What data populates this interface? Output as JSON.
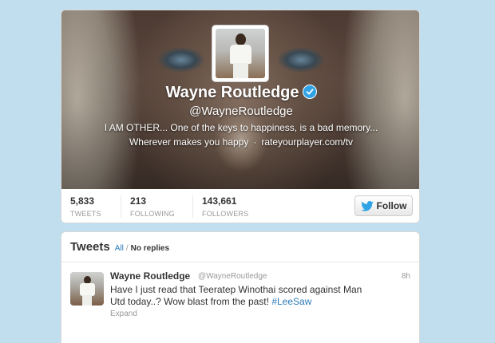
{
  "profile": {
    "name": "Wayne Routledge",
    "handle": "@WayneRoutledge",
    "bio": "I AM OTHER... One of the keys to happiness, is a bad memory...",
    "location": "Wherever makes you happy",
    "separator": "·",
    "website": "rateyourplayer.com/tv",
    "verified_icon": "verified-badge-icon"
  },
  "stats": [
    {
      "value": "5,833",
      "label": "TWEETS"
    },
    {
      "value": "213",
      "label": "FOLLOWING"
    },
    {
      "value": "143,661",
      "label": "FOLLOWERS"
    }
  ],
  "follow_button": {
    "label": "Follow",
    "icon": "twitter-bird-icon"
  },
  "tweets": {
    "title": "Tweets",
    "filter_all": "All",
    "filter_separator": "/",
    "filter_no_replies": "No replies",
    "items": [
      {
        "name": "Wayne Routledge",
        "handle": "@WayneRoutledge",
        "time": "8h",
        "text": "Have I just read that Teeratep Winothai scored against Man Utd today..? Wow blast from the past!",
        "hashtag": "#LeeSaw",
        "expand": "Expand"
      }
    ]
  },
  "colors": {
    "background": "#c0deed",
    "link": "#2b7bb9",
    "verified": "#2fa3e6"
  }
}
